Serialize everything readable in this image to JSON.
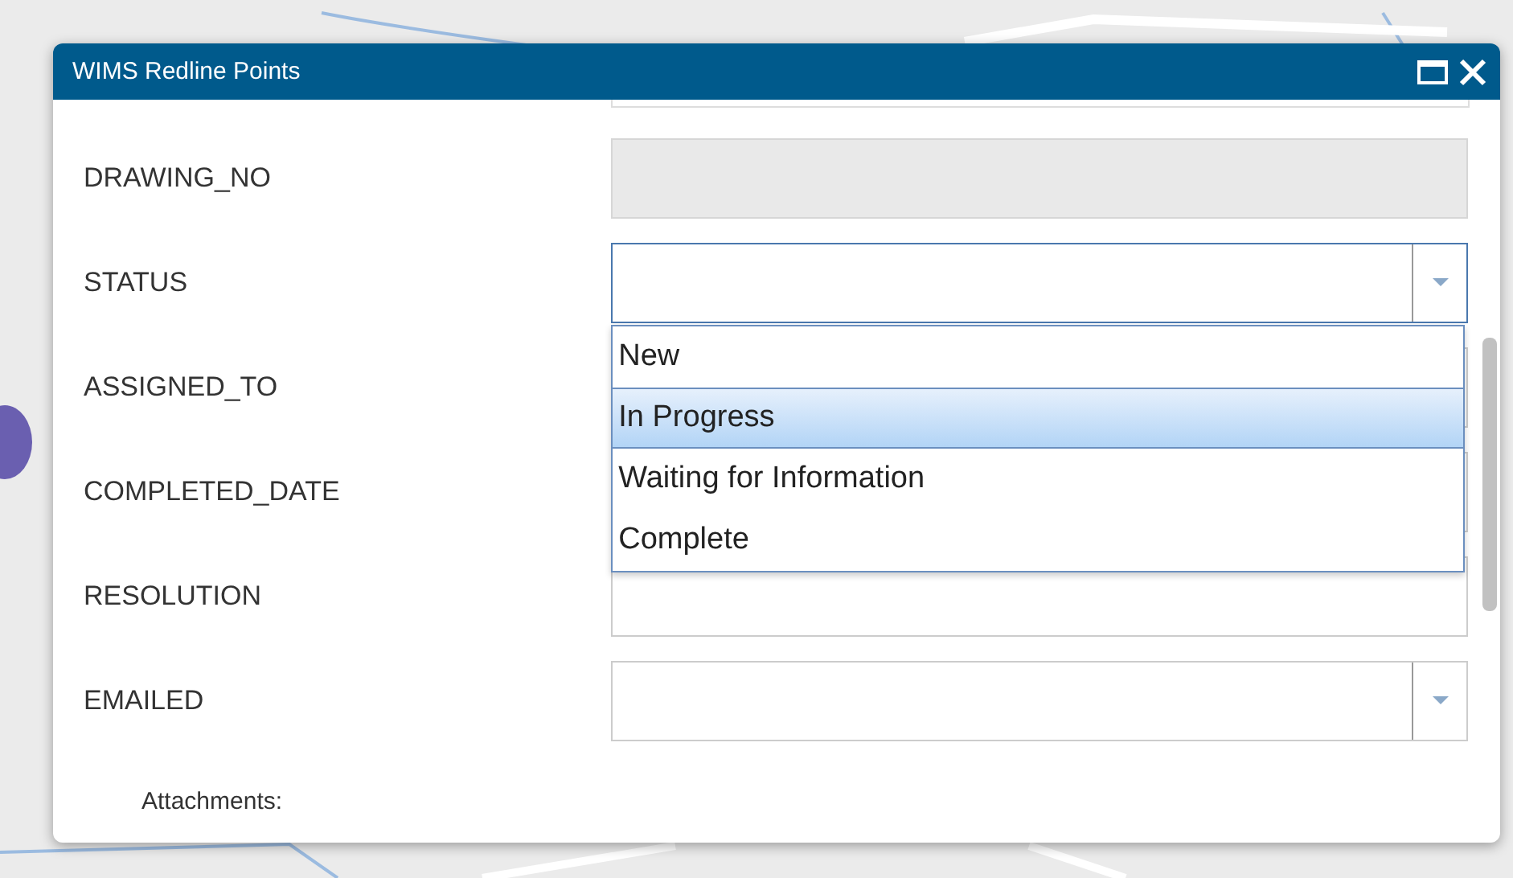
{
  "window": {
    "title": "WIMS Redline Points"
  },
  "fields": [
    {
      "label": "DRAWING_NO",
      "kind": "readonly"
    },
    {
      "label": "STATUS",
      "kind": "select",
      "options": [
        {
          "label": "New",
          "selected": false
        },
        {
          "label": "In Progress",
          "selected": true
        },
        {
          "label": "Waiting for Information",
          "selected": false
        },
        {
          "label": "Complete",
          "selected": false
        }
      ]
    },
    {
      "label": "ASSIGNED_TO",
      "kind": "text"
    },
    {
      "label": "COMPLETED_DATE",
      "kind": "text"
    },
    {
      "label": "RESOLUTION",
      "kind": "text"
    },
    {
      "label": "EMAILED",
      "kind": "select"
    }
  ],
  "attachments_label": "Attachments:"
}
